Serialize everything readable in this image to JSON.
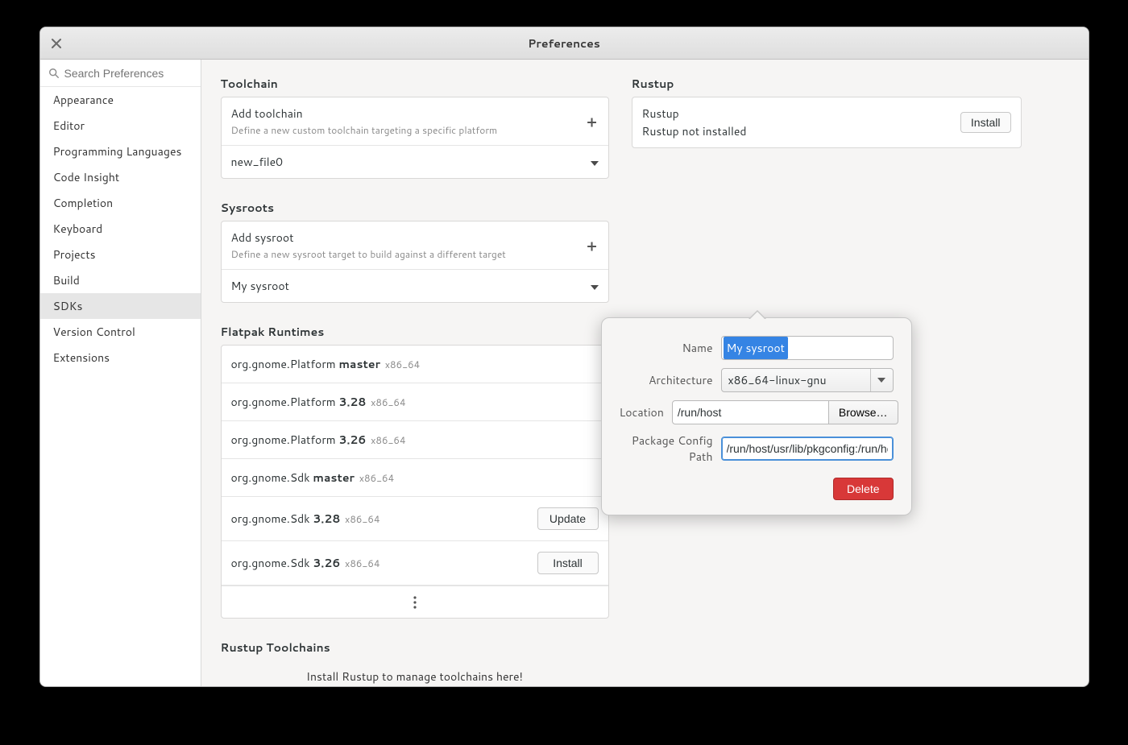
{
  "title": "Preferences",
  "search_placeholder": "Search Preferences",
  "sidebar": {
    "items": [
      {
        "label": "Appearance"
      },
      {
        "label": "Editor"
      },
      {
        "label": "Programming Languages"
      },
      {
        "label": "Code Insight"
      },
      {
        "label": "Completion"
      },
      {
        "label": "Keyboard"
      },
      {
        "label": "Projects"
      },
      {
        "label": "Build"
      },
      {
        "label": "SDKs",
        "selected": true
      },
      {
        "label": "Version Control"
      },
      {
        "label": "Extensions"
      }
    ]
  },
  "toolchain": {
    "section_title": "Toolchain",
    "add_label": "Add toolchain",
    "add_sublabel": "Define a new custom toolchain targeting a specific platform",
    "selected": "new_file0"
  },
  "sysroots": {
    "section_title": "Sysroots",
    "add_label": "Add sysroot",
    "add_sublabel": "Define a new sysroot target to build against a different target",
    "selected": "My sysroot"
  },
  "flatpak": {
    "section_title": "Flatpak Runtimes",
    "items": [
      {
        "name": "org.gnome.Platform",
        "ver": "master",
        "arch": "x86_64",
        "action": null
      },
      {
        "name": "org.gnome.Platform",
        "ver": "3.28",
        "arch": "x86_64",
        "action": null
      },
      {
        "name": "org.gnome.Platform",
        "ver": "3.26",
        "arch": "x86_64",
        "action": null
      },
      {
        "name": "org.gnome.Sdk",
        "ver": "master",
        "arch": "x86_64",
        "action": null
      },
      {
        "name": "org.gnome.Sdk",
        "ver": "3.28",
        "arch": "x86_64",
        "action": "Update"
      },
      {
        "name": "org.gnome.Sdk",
        "ver": "3.26",
        "arch": "x86_64",
        "action": "Install"
      }
    ]
  },
  "rustup_toolchains": {
    "section_title": "Rustup Toolchains",
    "hint": "Install Rustup to manage toolchains here!"
  },
  "rustup": {
    "section_title": "Rustup",
    "label": "Rustup",
    "sublabel": "Rustup not installed",
    "install_label": "Install"
  },
  "popover": {
    "fields": {
      "name_label": "Name",
      "name_value": "My sysroot",
      "arch_label": "Architecture",
      "arch_value": "x86_64-linux-gnu",
      "location_label": "Location",
      "location_value": "/run/host",
      "browse_label": "Browse…",
      "pkg_label": "Package Config Path",
      "pkg_value": "/run/host/usr/lib/pkgconfig:/run/host/usr"
    },
    "delete_label": "Delete"
  }
}
